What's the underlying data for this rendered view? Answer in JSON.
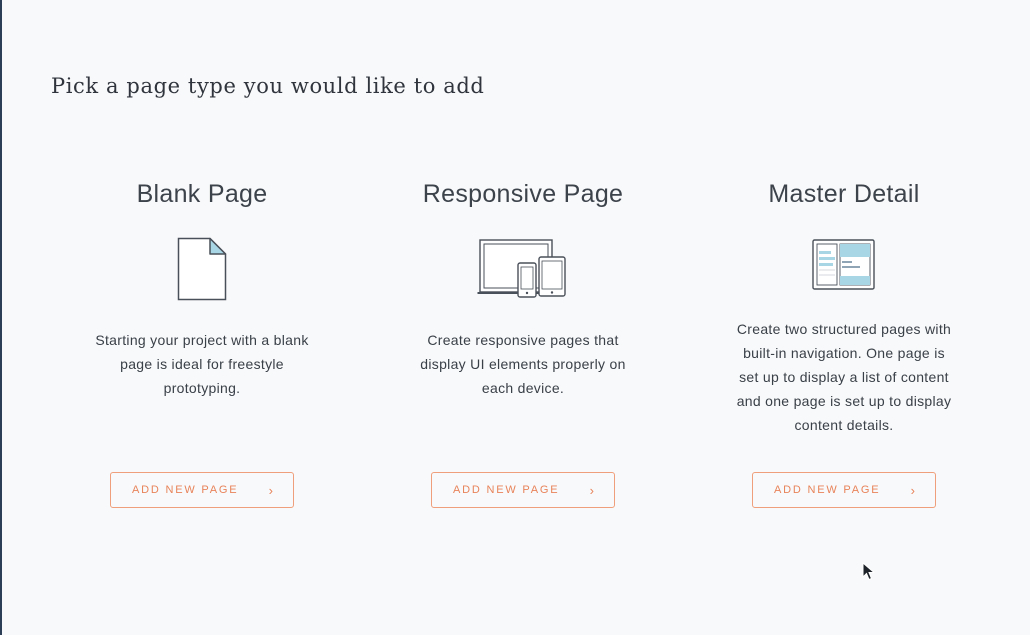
{
  "page": {
    "heading": "Pick a page type you would like to add"
  },
  "cards": [
    {
      "title": "Blank Page",
      "icon": "blank-page-icon",
      "description": "Starting your project with a blank page is ideal for freestyle prototyping.",
      "button_label": "ADD NEW PAGE",
      "button_icon": "chevron-right-icon"
    },
    {
      "title": "Responsive Page",
      "icon": "responsive-devices-icon",
      "description": "Create responsive pages that display UI elements properly on each device.",
      "button_label": "ADD NEW PAGE",
      "button_icon": "chevron-right-icon"
    },
    {
      "title": "Master Detail",
      "icon": "master-detail-icon",
      "description": "Create two structured pages with built-in navigation. One page is set up to display a list of content and one page is set up to display content details.",
      "button_label": "ADD NEW PAGE",
      "button_icon": "chevron-right-icon"
    }
  ],
  "colors": {
    "accent": "#e8835a",
    "accent_border": "#ef9f7b",
    "icon_fill": "#a9d6e5",
    "icon_stroke": "#4a5059",
    "background": "#f8f9fa"
  }
}
